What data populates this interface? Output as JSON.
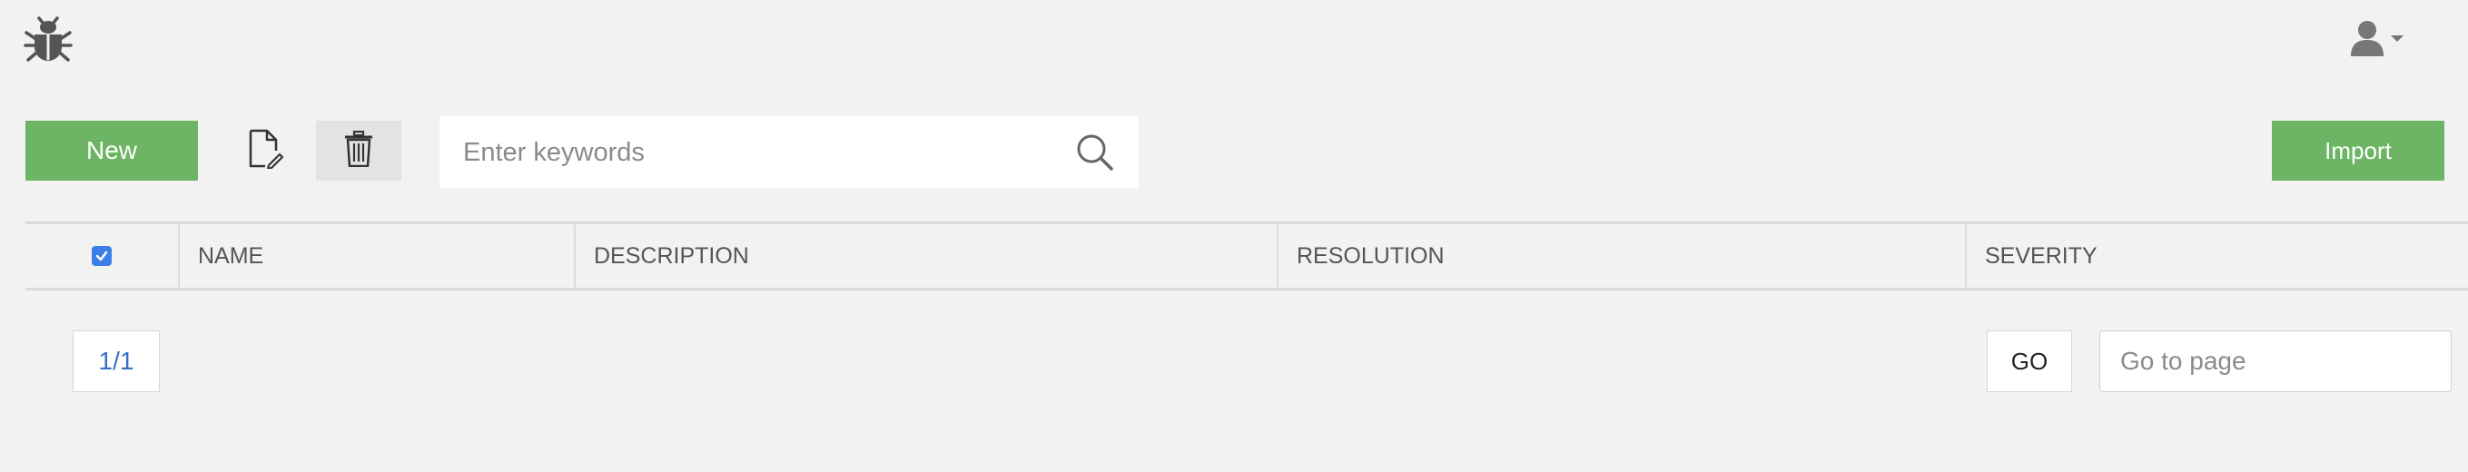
{
  "header": {
    "logo_icon": "bug-icon",
    "user_icon": "user-icon",
    "user_caret_icon": "caret-down-icon"
  },
  "toolbar": {
    "new_label": "New",
    "edit_icon": "edit-document-icon",
    "delete_icon": "trash-icon",
    "search_placeholder": "Enter keywords",
    "search_value": "",
    "search_icon": "search-icon",
    "import_label": "Import",
    "accent_color": "#6db564"
  },
  "table": {
    "select_all_checked": true,
    "columns": [
      "NAME",
      "DESCRIPTION",
      "RESOLUTION",
      "SEVERITY"
    ],
    "rows": []
  },
  "pagination": {
    "page_indicator": "1/1",
    "go_label": "GO",
    "goto_placeholder": "Go to page",
    "goto_value": ""
  }
}
